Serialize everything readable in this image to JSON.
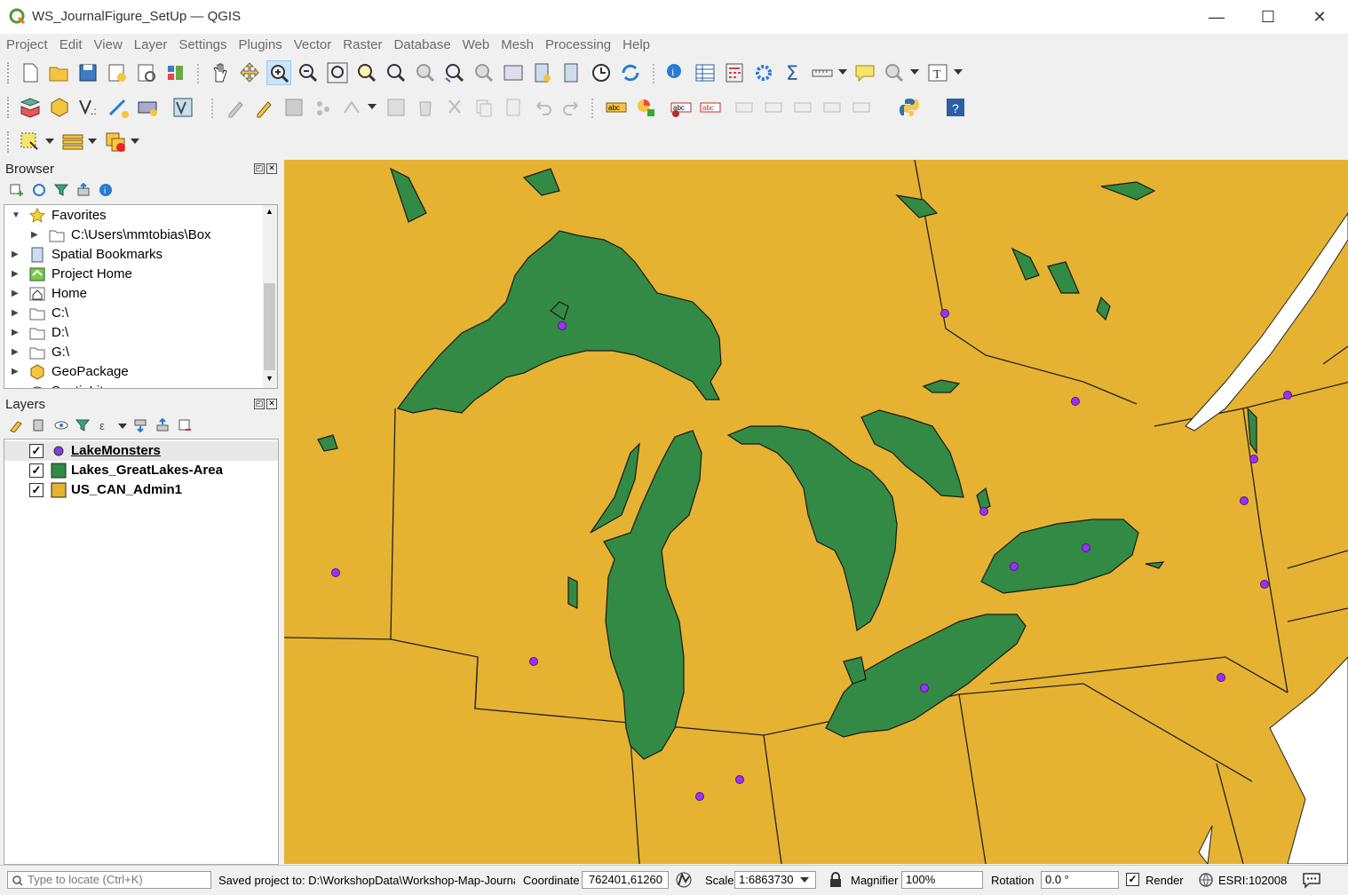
{
  "window": {
    "title": "WS_JournalFigure_SetUp — QGIS",
    "minimize": "—",
    "maximize": "☐",
    "close": "✕"
  },
  "menu": [
    "Project",
    "Edit",
    "View",
    "Layer",
    "Settings",
    "Plugins",
    "Vector",
    "Raster",
    "Database",
    "Web",
    "Mesh",
    "Processing",
    "Help"
  ],
  "browser": {
    "title": "Browser",
    "items": [
      {
        "label": "Favorites",
        "icon": "star-icon",
        "expanded": true
      },
      {
        "label": "C:\\Users\\mmtobias\\Box",
        "icon": "folder-icon",
        "indent": true
      },
      {
        "label": "Spatial Bookmarks",
        "icon": "bookmark-icon"
      },
      {
        "label": "Project Home",
        "icon": "project-home-icon"
      },
      {
        "label": "Home",
        "icon": "home-icon"
      },
      {
        "label": "C:\\",
        "icon": "folder-icon"
      },
      {
        "label": "D:\\",
        "icon": "folder-icon"
      },
      {
        "label": "G:\\",
        "icon": "folder-icon"
      },
      {
        "label": "GeoPackage",
        "icon": "geopackage-icon"
      },
      {
        "label": "SpatiaLite",
        "icon": "spatialite-icon"
      }
    ]
  },
  "layers": {
    "title": "Layers",
    "items": [
      {
        "label": "LakeMonsters",
        "checked": true,
        "symbol": "point",
        "color": "#7b3fe4",
        "underline": true
      },
      {
        "label": "Lakes_GreatLakes-Area",
        "checked": true,
        "symbol": "polygon",
        "color": "#328a44"
      },
      {
        "label": "US_CAN_Admin1",
        "checked": true,
        "symbol": "polygon",
        "color": "#e5b232"
      }
    ]
  },
  "map": {
    "land_color": "#e5b232",
    "lake_color": "#328a44",
    "point_color": "#9b30ff",
    "water_color": "#ffffff"
  },
  "status": {
    "locate_placeholder": "Type to locate (Ctrl+K)",
    "message": "Saved project to: D:\\WorkshopData\\Workshop-Map-Journa",
    "coordinate_label": "Coordinate",
    "coordinate": "762401,61260",
    "scale_label": "Scale",
    "scale": "1:6863730",
    "magnifier_label": "Magnifier",
    "magnifier": "100%",
    "rotation_label": "Rotation",
    "rotation": "0.0 °",
    "render_label": "Render",
    "crs": "ESRI:102008"
  }
}
